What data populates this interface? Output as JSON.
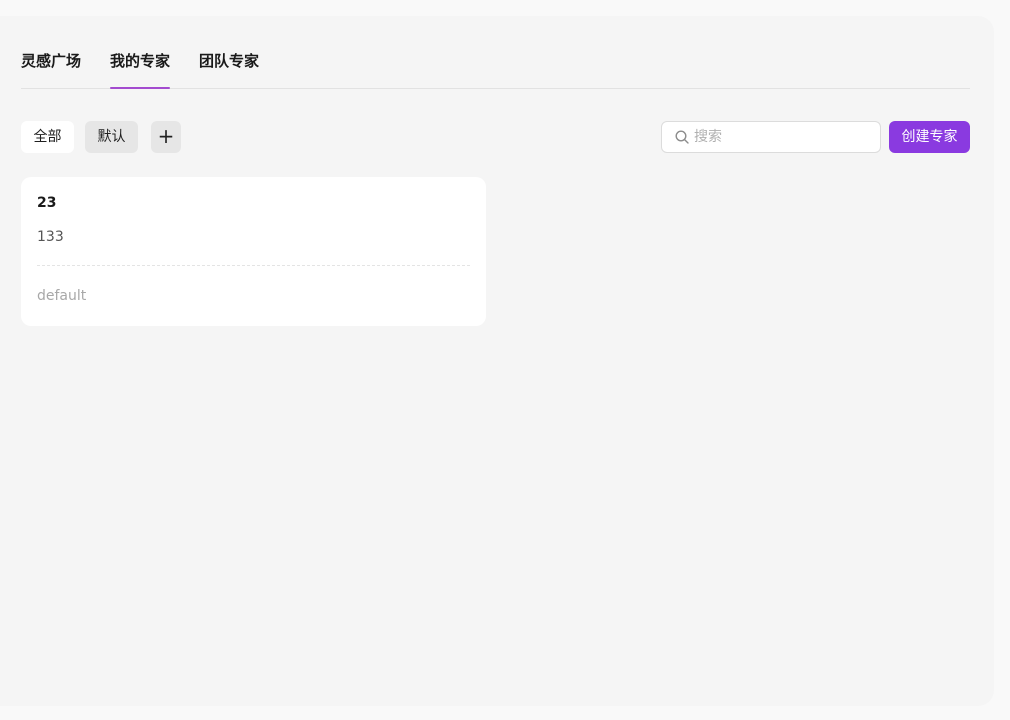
{
  "tabs": [
    {
      "label": "灵感广场",
      "active": false
    },
    {
      "label": "我的专家",
      "active": true
    },
    {
      "label": "团队专家",
      "active": false
    }
  ],
  "filters": {
    "all_label": "全部",
    "default_label": "默认",
    "add_label": "+"
  },
  "search": {
    "placeholder": "搜索",
    "value": "",
    "icon": "search-icon"
  },
  "actions": {
    "create_label": "创建专家"
  },
  "experts": [
    {
      "title": "23",
      "description": "133",
      "group": "default"
    }
  ],
  "colors": {
    "accent": "#8a3ae0",
    "tab_underline": "#a34bcf",
    "panel_bg": "#f5f5f5"
  }
}
